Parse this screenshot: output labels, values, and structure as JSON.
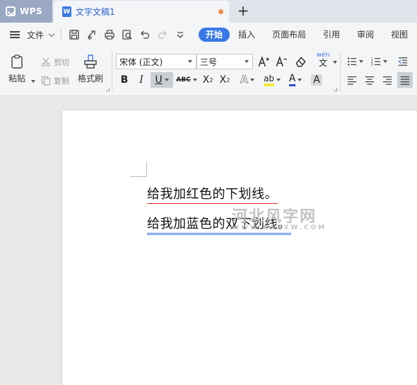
{
  "app": {
    "name": "WPS"
  },
  "document_tab": {
    "title": "文字文稿1",
    "icon": "W"
  },
  "menu": {
    "file_label": "文件",
    "tabs": [
      {
        "label": "开始",
        "active": true
      },
      {
        "label": "插入",
        "active": false
      },
      {
        "label": "页面布局",
        "active": false
      },
      {
        "label": "引用",
        "active": false
      },
      {
        "label": "审阅",
        "active": false
      },
      {
        "label": "视图",
        "active": false
      }
    ]
  },
  "ribbon": {
    "paste_label": "粘贴",
    "cut_label": "剪切",
    "copy_label": "复制",
    "format_painter_label": "格式刷",
    "font_name": "宋体 (正文)",
    "font_size": "三号",
    "phonetic_label": "wén",
    "abc_label": "ABC"
  },
  "document": {
    "lines": [
      {
        "text": "给我加红色的下划线。",
        "underline": "single",
        "underline_color": "#e53030"
      },
      {
        "text": "给我加蓝色的双下划线。",
        "underline": "double",
        "underline_color": "#3b78e7"
      }
    ],
    "watermark": {
      "main": "河北风字网",
      "sub": "WWW.KSZXW.COM"
    }
  },
  "colors": {
    "accent": "#3b78e7",
    "unsaved": "#f08b4a",
    "app_tab": "#9aa8c4"
  }
}
